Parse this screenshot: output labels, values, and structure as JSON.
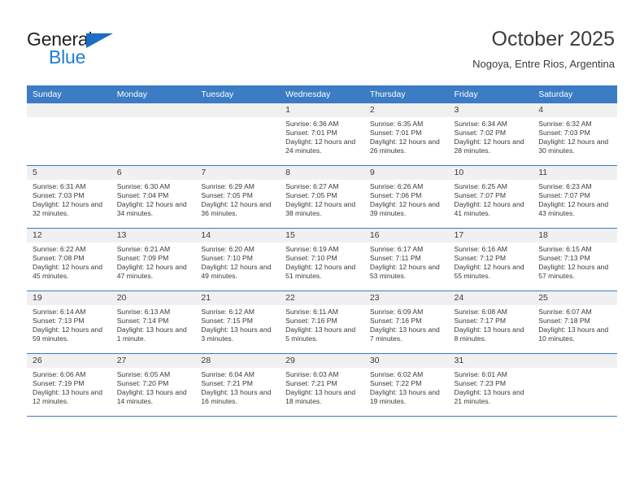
{
  "brand": {
    "name_top": "General",
    "name_bottom": "Blue",
    "triangle_icon": "brand-triangle-icon"
  },
  "header": {
    "title": "October 2025",
    "subtitle": "Nogoya, Entre Rios, Argentina"
  },
  "colors": {
    "header_blue": "#3b7cc4",
    "brand_blue": "#1b7fd4",
    "day_band_gray": "#f0f0f0",
    "text": "#3a3a3a"
  },
  "weekday_headers": [
    "Sunday",
    "Monday",
    "Tuesday",
    "Wednesday",
    "Thursday",
    "Friday",
    "Saturday"
  ],
  "weeks": [
    [
      {
        "day": "",
        "detail": ""
      },
      {
        "day": "",
        "detail": ""
      },
      {
        "day": "",
        "detail": ""
      },
      {
        "day": "1",
        "detail": "Sunrise: 6:36 AM\nSunset: 7:01 PM\nDaylight: 12 hours and 24 minutes."
      },
      {
        "day": "2",
        "detail": "Sunrise: 6:35 AM\nSunset: 7:01 PM\nDaylight: 12 hours and 26 minutes."
      },
      {
        "day": "3",
        "detail": "Sunrise: 6:34 AM\nSunset: 7:02 PM\nDaylight: 12 hours and 28 minutes."
      },
      {
        "day": "4",
        "detail": "Sunrise: 6:32 AM\nSunset: 7:03 PM\nDaylight: 12 hours and 30 minutes."
      }
    ],
    [
      {
        "day": "5",
        "detail": "Sunrise: 6:31 AM\nSunset: 7:03 PM\nDaylight: 12 hours and 32 minutes."
      },
      {
        "day": "6",
        "detail": "Sunrise: 6:30 AM\nSunset: 7:04 PM\nDaylight: 12 hours and 34 minutes."
      },
      {
        "day": "7",
        "detail": "Sunrise: 6:29 AM\nSunset: 7:05 PM\nDaylight: 12 hours and 36 minutes."
      },
      {
        "day": "8",
        "detail": "Sunrise: 6:27 AM\nSunset: 7:05 PM\nDaylight: 12 hours and 38 minutes."
      },
      {
        "day": "9",
        "detail": "Sunrise: 6:26 AM\nSunset: 7:06 PM\nDaylight: 12 hours and 39 minutes."
      },
      {
        "day": "10",
        "detail": "Sunrise: 6:25 AM\nSunset: 7:07 PM\nDaylight: 12 hours and 41 minutes."
      },
      {
        "day": "11",
        "detail": "Sunrise: 6:23 AM\nSunset: 7:07 PM\nDaylight: 12 hours and 43 minutes."
      }
    ],
    [
      {
        "day": "12",
        "detail": "Sunrise: 6:22 AM\nSunset: 7:08 PM\nDaylight: 12 hours and 45 minutes."
      },
      {
        "day": "13",
        "detail": "Sunrise: 6:21 AM\nSunset: 7:09 PM\nDaylight: 12 hours and 47 minutes."
      },
      {
        "day": "14",
        "detail": "Sunrise: 6:20 AM\nSunset: 7:10 PM\nDaylight: 12 hours and 49 minutes."
      },
      {
        "day": "15",
        "detail": "Sunrise: 6:19 AM\nSunset: 7:10 PM\nDaylight: 12 hours and 51 minutes."
      },
      {
        "day": "16",
        "detail": "Sunrise: 6:17 AM\nSunset: 7:11 PM\nDaylight: 12 hours and 53 minutes."
      },
      {
        "day": "17",
        "detail": "Sunrise: 6:16 AM\nSunset: 7:12 PM\nDaylight: 12 hours and 55 minutes."
      },
      {
        "day": "18",
        "detail": "Sunrise: 6:15 AM\nSunset: 7:13 PM\nDaylight: 12 hours and 57 minutes."
      }
    ],
    [
      {
        "day": "19",
        "detail": "Sunrise: 6:14 AM\nSunset: 7:13 PM\nDaylight: 12 hours and 59 minutes."
      },
      {
        "day": "20",
        "detail": "Sunrise: 6:13 AM\nSunset: 7:14 PM\nDaylight: 13 hours and 1 minute."
      },
      {
        "day": "21",
        "detail": "Sunrise: 6:12 AM\nSunset: 7:15 PM\nDaylight: 13 hours and 3 minutes."
      },
      {
        "day": "22",
        "detail": "Sunrise: 6:11 AM\nSunset: 7:16 PM\nDaylight: 13 hours and 5 minutes."
      },
      {
        "day": "23",
        "detail": "Sunrise: 6:09 AM\nSunset: 7:16 PM\nDaylight: 13 hours and 7 minutes."
      },
      {
        "day": "24",
        "detail": "Sunrise: 6:08 AM\nSunset: 7:17 PM\nDaylight: 13 hours and 8 minutes."
      },
      {
        "day": "25",
        "detail": "Sunrise: 6:07 AM\nSunset: 7:18 PM\nDaylight: 13 hours and 10 minutes."
      }
    ],
    [
      {
        "day": "26",
        "detail": "Sunrise: 6:06 AM\nSunset: 7:19 PM\nDaylight: 13 hours and 12 minutes."
      },
      {
        "day": "27",
        "detail": "Sunrise: 6:05 AM\nSunset: 7:20 PM\nDaylight: 13 hours and 14 minutes."
      },
      {
        "day": "28",
        "detail": "Sunrise: 6:04 AM\nSunset: 7:21 PM\nDaylight: 13 hours and 16 minutes."
      },
      {
        "day": "29",
        "detail": "Sunrise: 6:03 AM\nSunset: 7:21 PM\nDaylight: 13 hours and 18 minutes."
      },
      {
        "day": "30",
        "detail": "Sunrise: 6:02 AM\nSunset: 7:22 PM\nDaylight: 13 hours and 19 minutes."
      },
      {
        "day": "31",
        "detail": "Sunrise: 6:01 AM\nSunset: 7:23 PM\nDaylight: 13 hours and 21 minutes."
      },
      {
        "day": "",
        "detail": ""
      }
    ]
  ]
}
